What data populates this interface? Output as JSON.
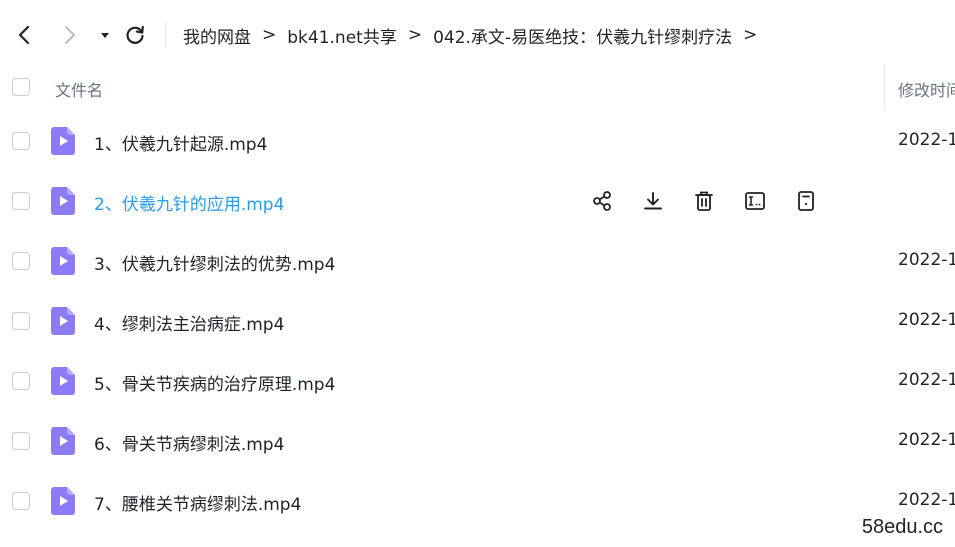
{
  "nav": {
    "back_icon": "chevron-left-icon",
    "forward_icon": "chevron-right-icon",
    "history_icon": "caret-down-icon",
    "refresh_icon": "refresh-icon"
  },
  "breadcrumb": {
    "items": [
      "我的网盘",
      "bk41.net共享",
      "042.承文-易医绝技：伏羲九针缪刺疗法"
    ],
    "separator": ">"
  },
  "header": {
    "name_label": "文件名",
    "modified_label": "修改时间"
  },
  "files": [
    {
      "name": "1、伏羲九针起源.mp4",
      "date": "2022-1"
    },
    {
      "name": "2、伏羲九针的应用.mp4",
      "date": ""
    },
    {
      "name": "3、伏羲九针缪刺法的优势.mp4",
      "date": "2022-1"
    },
    {
      "name": "4、缪刺法主治病症.mp4",
      "date": "2022-1"
    },
    {
      "name": "5、骨关节疾病的治疗原理.mp4",
      "date": "2022-1"
    },
    {
      "name": "6、骨关节病缪刺法.mp4",
      "date": "2022-1"
    },
    {
      "name": "7、腰椎关节病缪刺法.mp4",
      "date": "2022-1"
    }
  ],
  "row_actions": [
    "share-icon",
    "download-icon",
    "delete-icon",
    "rename-icon",
    "details-icon"
  ],
  "colors": {
    "file_icon": "#8b7cf6",
    "hover_text": "#2a9be8"
  },
  "watermark": "58edu.cc"
}
